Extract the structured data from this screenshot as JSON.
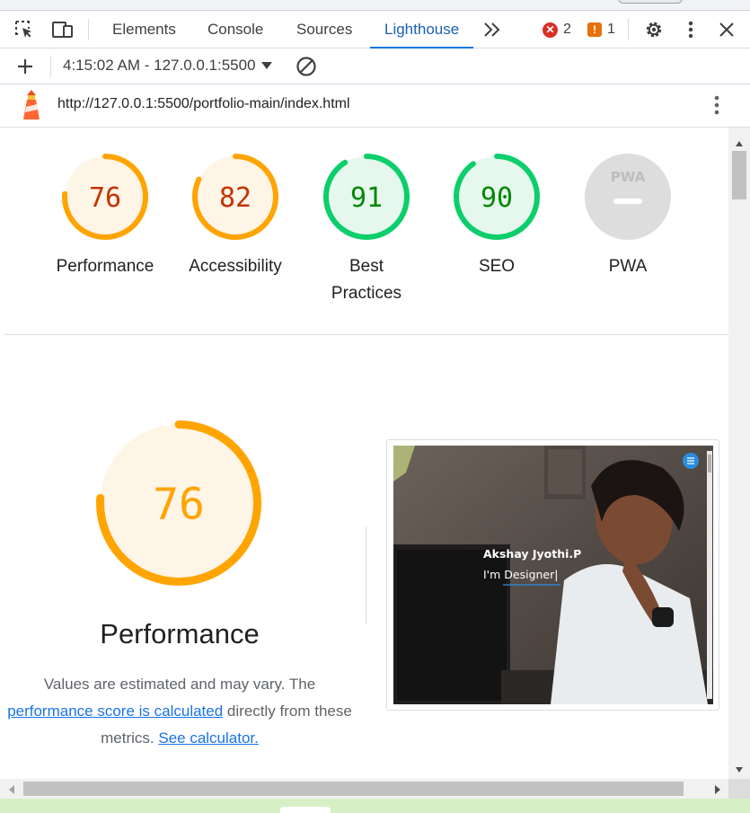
{
  "devtools": {
    "tabs": [
      {
        "label": "Elements",
        "active": false
      },
      {
        "label": "Console",
        "active": false
      },
      {
        "label": "Sources",
        "active": false
      },
      {
        "label": "Lighthouse",
        "active": true
      }
    ],
    "error_count": "2",
    "warning_count": "1",
    "accent_color": "#1a73e8"
  },
  "report_toolbar": {
    "selected_report": "4:15:02 AM - 127.0.0.1:5500"
  },
  "url_bar": {
    "url": "http://127.0.0.1:5500/portfolio-main/index.html"
  },
  "scores": [
    {
      "label": "Performance",
      "value": "76",
      "score": 0.76,
      "status": "average",
      "color": "#ffa400",
      "text_color": "#c33300"
    },
    {
      "label": "Accessibility",
      "value": "82",
      "score": 0.82,
      "status": "average",
      "color": "#ffa400",
      "text_color": "#c33300"
    },
    {
      "label": "Best Practices",
      "value": "91",
      "score": 0.91,
      "status": "pass",
      "color": "#0cce6b",
      "text_color": "#008800"
    },
    {
      "label": "SEO",
      "value": "90",
      "score": 0.9,
      "status": "pass",
      "color": "#0cce6b",
      "text_color": "#008800"
    },
    {
      "label": "PWA",
      "value": "PWA",
      "score": null,
      "status": "na",
      "color": "#dddddd",
      "text_color": "#ffffff"
    }
  ],
  "performance": {
    "score": "76",
    "fraction": 0.76,
    "title": "Performance",
    "desc_line1": "Values are estimated and may vary. The",
    "link1": "performance score is calculated",
    "desc_mid": " directly from these metrics. ",
    "link2": "See calculator."
  },
  "screenshot": {
    "name": "Akshay Jyothi.P",
    "tagline": "I'm Designer|"
  }
}
